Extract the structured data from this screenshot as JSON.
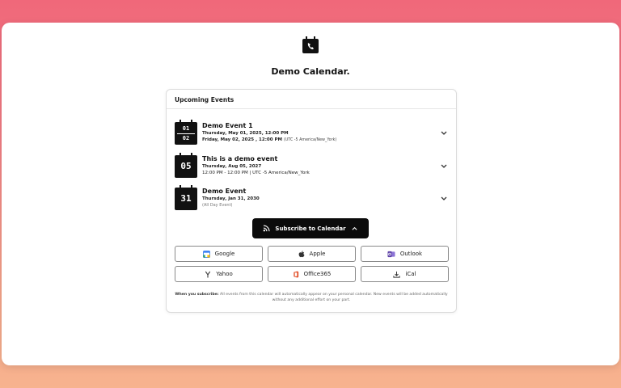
{
  "calendar": {
    "title": "Demo Calendar."
  },
  "card": {
    "header": "Upcoming Events"
  },
  "events": [
    {
      "day_top": "01",
      "day_bottom": "02",
      "title": "Demo Event 1",
      "line1": "Thursday, May 01, 2025, 12:00 PM",
      "line2": "Friday, May 02, 2025 , 12:00 PM",
      "tz": "(UTC -5 America/New_York)"
    },
    {
      "day": "05",
      "title": "This is a demo event",
      "line1": "Thursday, Aug 05, 2027",
      "line2": "12:00 PM - 12:00 PM | UTC -5 America/New_York"
    },
    {
      "day": "31",
      "title": "Demo Event",
      "line1": "Thursday, Jan 31, 2030",
      "note": "(All Day Event)"
    }
  ],
  "subscribe": {
    "label": "Subscribe to Calendar"
  },
  "providers": [
    {
      "label": "Google",
      "icon": "google-calendar-icon"
    },
    {
      "label": "Apple",
      "icon": "apple-icon"
    },
    {
      "label": "Outlook",
      "icon": "outlook-icon"
    },
    {
      "label": "Yahoo",
      "icon": "yahoo-icon"
    },
    {
      "label": "Office365",
      "icon": "office365-icon"
    },
    {
      "label": "iCal",
      "icon": "download-icon"
    }
  ],
  "footnote": {
    "lead": "When you subscribe:",
    "text": "All events from this calendar will automatically appear on your personal calendar. New events will be added automatically without any additional effort on your part."
  },
  "colors": {
    "primary": "#0b0b0b",
    "google": "#4285f4",
    "outlook": "#5b3fa6",
    "office": "#e2502a"
  }
}
